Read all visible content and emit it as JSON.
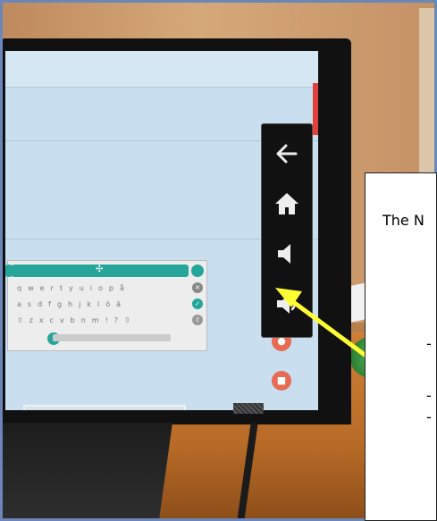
{
  "callout": {
    "title": "The N",
    "bullets": [
      "-",
      "-",
      "-"
    ]
  },
  "nav_bar": {
    "buttons": [
      "back-arrow-icon",
      "home-icon",
      "volume-down-icon",
      "volume-up-icon"
    ]
  },
  "colors": {
    "frame_border": "#6b86b8",
    "accent_arrow": "#ffff33",
    "keyboard_accent": "#26a69a",
    "float_button": "#e86a52"
  }
}
